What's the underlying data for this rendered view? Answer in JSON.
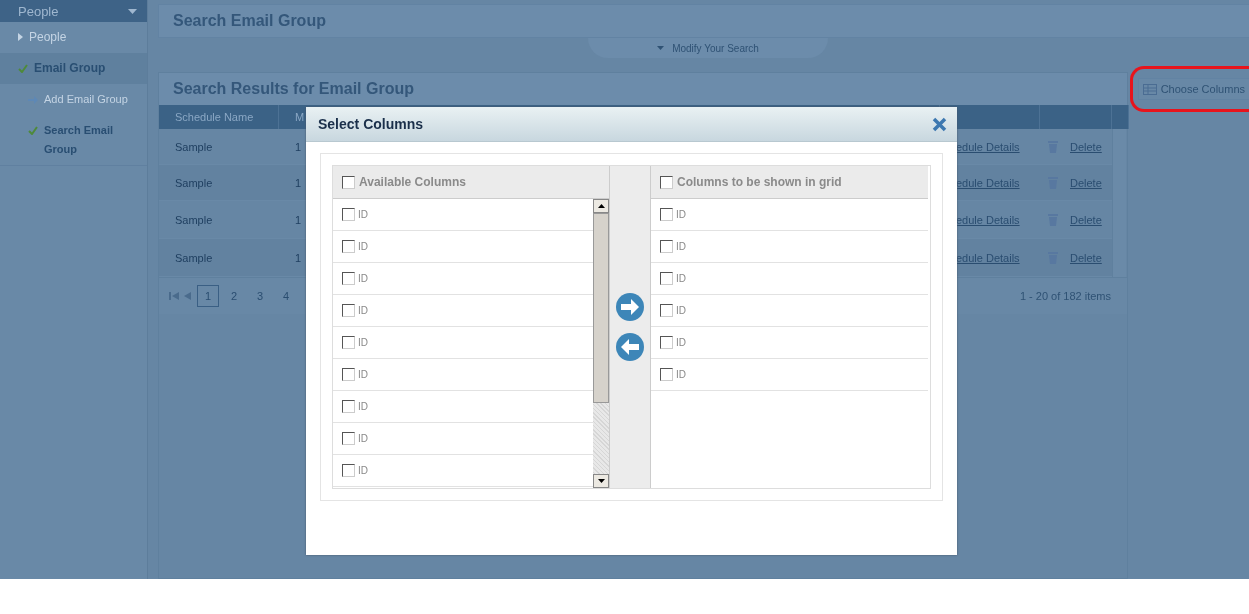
{
  "sidebar": {
    "title": "People",
    "items": [
      {
        "label": "People",
        "selected": false
      },
      {
        "label": "Email Group",
        "selected": true,
        "children": [
          {
            "label": "Add Email Group",
            "selected": false
          },
          {
            "label": "Search Email Group",
            "selected": true
          }
        ]
      }
    ]
  },
  "search_panel": {
    "title": "Search Email Group",
    "toggle": "Modify Your Search"
  },
  "results": {
    "title": "Search Results for Email Group",
    "choose_columns": "Choose Columns",
    "columns": [
      "Schedule Name",
      "M"
    ],
    "rows": [
      {
        "name": "Sample",
        "column_2": "1",
        "details": "edule Details",
        "delete": "Delete"
      },
      {
        "name": "Sample",
        "column_2": "1",
        "details": "edule Details",
        "delete": "Delete"
      },
      {
        "name": "Sample",
        "column_2": "1",
        "details": "edule Details",
        "delete": "Delete"
      },
      {
        "name": "Sample",
        "column_2": "1",
        "details": "edule Details",
        "delete": "Delete"
      }
    ],
    "pages": [
      {
        "label": "1",
        "selected": true
      },
      {
        "label": "2",
        "selected": false
      },
      {
        "label": "3",
        "selected": false
      },
      {
        "label": "4",
        "selected": false
      }
    ],
    "count": "1 - 20 of 182 items"
  },
  "dialog": {
    "title": "Select Columns",
    "available": {
      "heading": "Available Columns",
      "checked": false,
      "items": [
        {
          "label": "ID",
          "checked": false
        },
        {
          "label": "ID",
          "checked": false
        },
        {
          "label": "ID",
          "checked": false
        },
        {
          "label": "ID",
          "checked": false
        },
        {
          "label": "ID",
          "checked": false
        },
        {
          "label": "ID",
          "checked": false
        },
        {
          "label": "ID",
          "checked": false
        },
        {
          "label": "ID",
          "checked": false
        },
        {
          "label": "ID",
          "checked": false
        }
      ]
    },
    "shown": {
      "heading": "Columns to be shown in grid",
      "checked": false,
      "items": [
        {
          "label": "ID",
          "checked": false
        },
        {
          "label": "ID",
          "checked": false
        },
        {
          "label": "ID",
          "checked": false
        },
        {
          "label": "ID",
          "checked": false
        },
        {
          "label": "ID",
          "checked": false
        },
        {
          "label": "ID",
          "checked": false
        }
      ]
    }
  }
}
